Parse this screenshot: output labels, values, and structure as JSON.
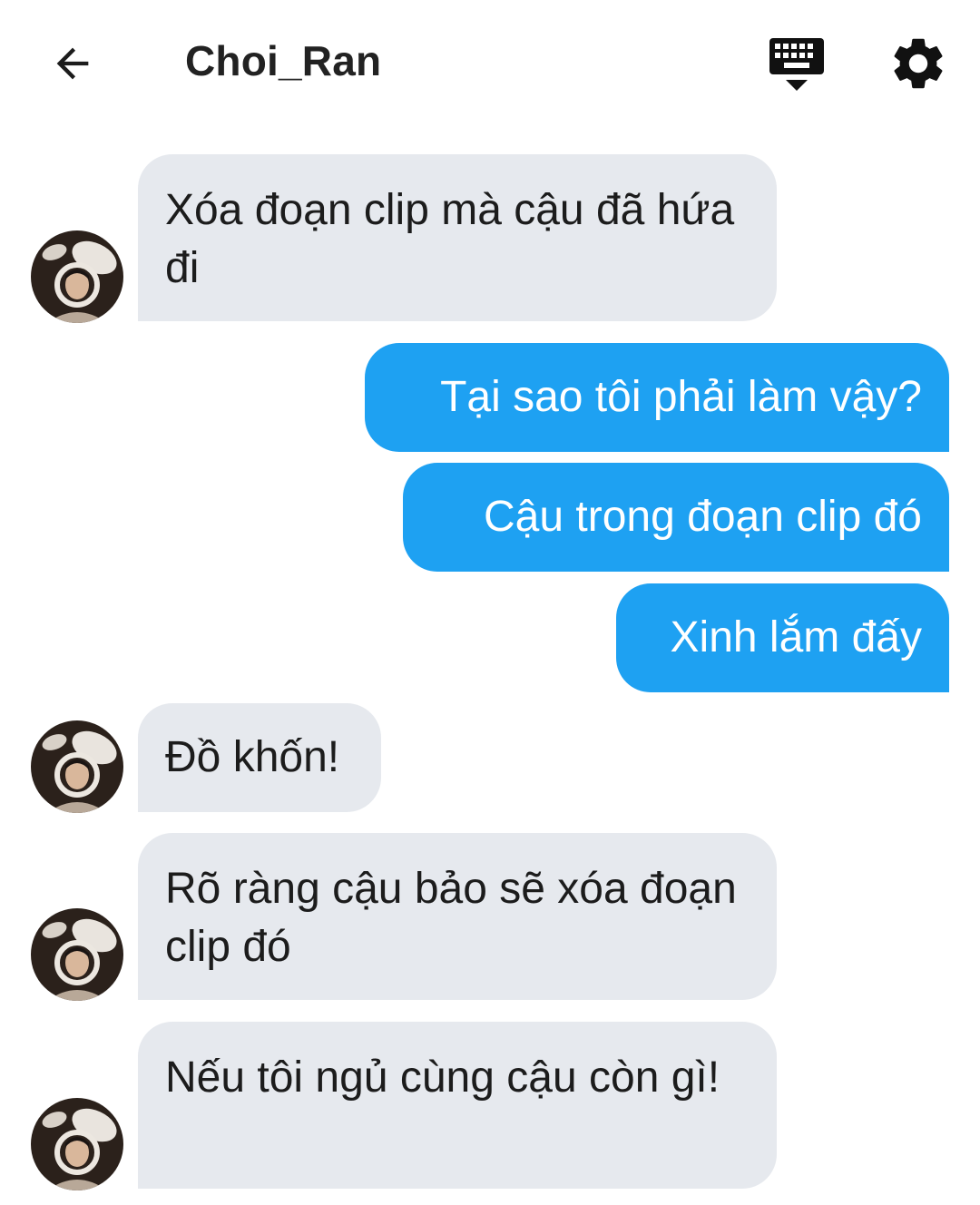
{
  "header": {
    "title": "Choi_Ran",
    "back_icon": "arrow-left-icon",
    "keyboard_icon": "keyboard-hide-icon",
    "settings_icon": "gear-icon"
  },
  "colors": {
    "incoming_bubble": "#e6e9ee",
    "outgoing_bubble": "#1ea1f2",
    "text": "#1c1c1c"
  },
  "messages": [
    {
      "side": "in",
      "text": "Xóa đoạn clip mà cậu đã hứa đi"
    },
    {
      "side": "out",
      "text": "Tại sao tôi phải làm vậy?"
    },
    {
      "side": "out",
      "text": "Cậu trong đoạn clip đó"
    },
    {
      "side": "out",
      "text": "Xinh lắm đấy"
    },
    {
      "side": "in",
      "text": "Đồ khốn!"
    },
    {
      "side": "in",
      "text": "Rõ ràng cậu bảo sẽ xóa đoạn clip đó"
    },
    {
      "side": "in",
      "text": "Nếu tôi ngủ cùng cậu còn gì!"
    }
  ]
}
